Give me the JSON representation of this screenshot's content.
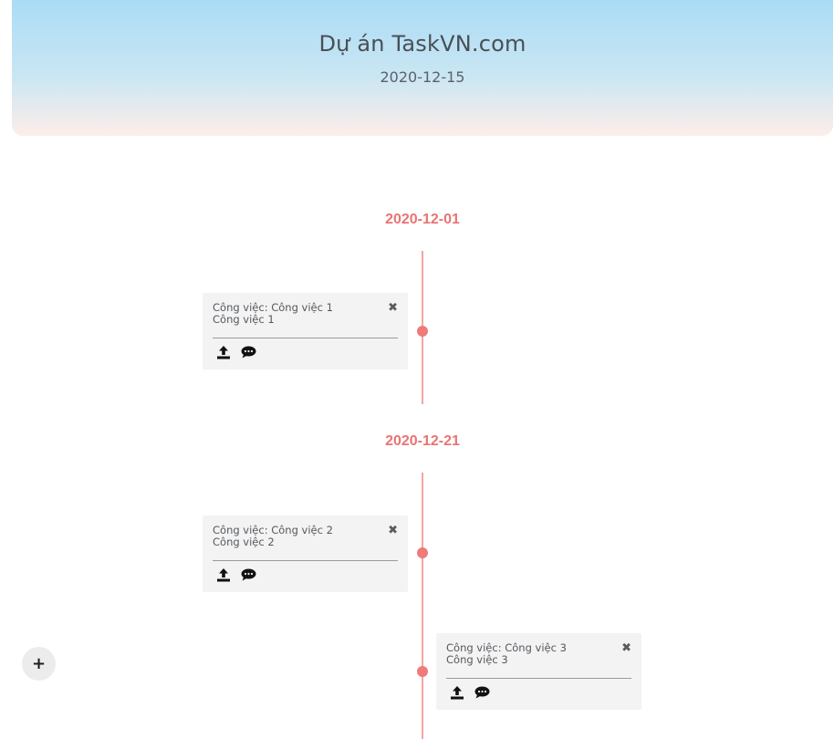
{
  "header": {
    "title": "Dự án TaskVN.com",
    "date": "2020-12-15"
  },
  "groups": [
    {
      "date": "2020-12-01",
      "tasks": [
        {
          "title": "Công việc: Công việc 1",
          "name": "Công việc 1",
          "side": "left"
        }
      ]
    },
    {
      "date": "2020-12-21",
      "tasks": [
        {
          "title": "Công việc: Công việc 2",
          "name": "Công việc 2",
          "side": "left"
        },
        {
          "title": "Công việc: Công việc 3",
          "name": "Công việc 3",
          "side": "right"
        }
      ]
    }
  ],
  "icons": {
    "close": "close-icon",
    "upload": "upload-icon",
    "comment": "comment-icon",
    "add": "plus-icon"
  },
  "colors": {
    "accent": "#e97474",
    "timeline": "#f2a6a6",
    "dot": "#ee7a7a",
    "card": "#f3f3f3"
  },
  "add_button_label": "+"
}
